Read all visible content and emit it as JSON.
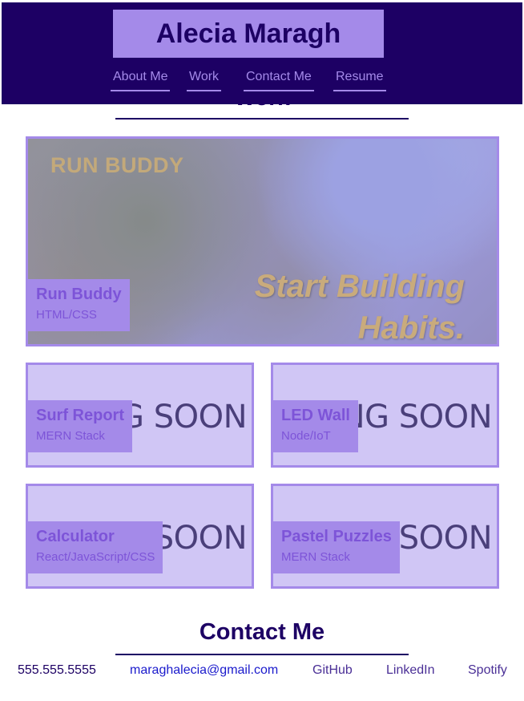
{
  "header": {
    "title": "Alecia Maragh",
    "nav": [
      {
        "label": "About Me"
      },
      {
        "label": "Work"
      },
      {
        "label": "Contact Me"
      },
      {
        "label": "Resume"
      }
    ]
  },
  "work": {
    "heading": "Work",
    "featured": {
      "logo_text": "RUN BUDDY",
      "tagline_1": "Start Building",
      "tagline_2": "Habits.",
      "name": "Run Buddy",
      "stack": "HTML/CSS"
    },
    "projects": [
      {
        "name": "Surf Report",
        "stack": "MERN Stack",
        "placeholder": "G SOON"
      },
      {
        "name": "LED Wall",
        "stack": "Node/IoT",
        "placeholder": "NG SOON"
      },
      {
        "name": "Calculator",
        "stack": "React/JavaScript/CSS",
        "placeholder": "SOON"
      },
      {
        "name": "Pastel Puzzles",
        "stack": "MERN Stack",
        "placeholder": "SOON"
      }
    ]
  },
  "contact": {
    "heading": "Contact Me",
    "phone": "555.555.5555",
    "email": "maraghalecia@gmail.com",
    "links": [
      "GitHub",
      "LinkedIn",
      "Spotify"
    ]
  },
  "colors": {
    "primary": "#1d0064",
    "accent": "#a48ae9",
    "card_bg": "#d0c6f5"
  }
}
